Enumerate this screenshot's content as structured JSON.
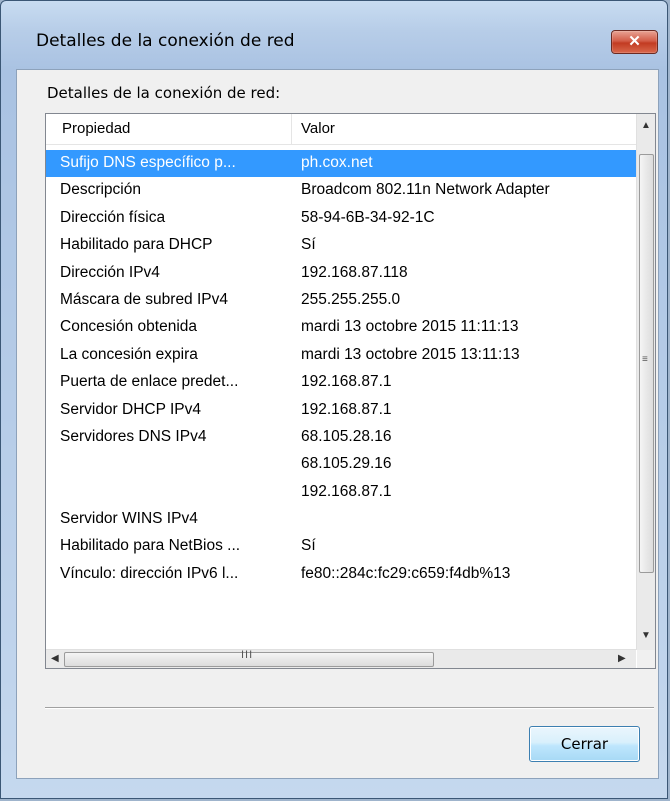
{
  "window": {
    "title": "Detalles de la conexión de red",
    "close_glyph": "✕"
  },
  "group_label": "Detalles de la conexión de red:",
  "table": {
    "columns": [
      "Propiedad",
      "Valor"
    ],
    "rows": [
      [
        "Sufijo DNS específico p...",
        "ph.cox.net"
      ],
      [
        "Descripción",
        "Broadcom 802.11n Network Adapter"
      ],
      [
        "Dirección física",
        "58-94-6B-34-92-1C"
      ],
      [
        "Habilitado para DHCP",
        "Sí"
      ],
      [
        "Dirección IPv4",
        "192.168.87.118"
      ],
      [
        "Máscara de subred IPv4",
        "255.255.255.0"
      ],
      [
        "Concesión obtenida",
        "mardi 13 octobre 2015 11:11:13"
      ],
      [
        "La concesión expira",
        "mardi 13 octobre 2015 13:11:13"
      ],
      [
        "Puerta de enlace predet...",
        "192.168.87.1"
      ],
      [
        "Servidor DHCP IPv4",
        "192.168.87.1"
      ],
      [
        "Servidores DNS IPv4",
        "68.105.28.16"
      ],
      [
        "",
        "68.105.29.16"
      ],
      [
        "",
        "192.168.87.1"
      ],
      [
        "Servidor WINS IPv4",
        ""
      ],
      [
        "Habilitado para NetBios ...",
        "Sí"
      ],
      [
        "Vínculo: dirección IPv6 l...",
        "fe80::284c:fc29:c659:f4db%13"
      ]
    ],
    "selected_row": 0
  },
  "scroll": {
    "up": "▲",
    "down": "▼",
    "left": "◀",
    "right": "▶",
    "h_grip": "III",
    "v_grip": "≡"
  },
  "buttons": {
    "close_label": "Cerrar"
  }
}
